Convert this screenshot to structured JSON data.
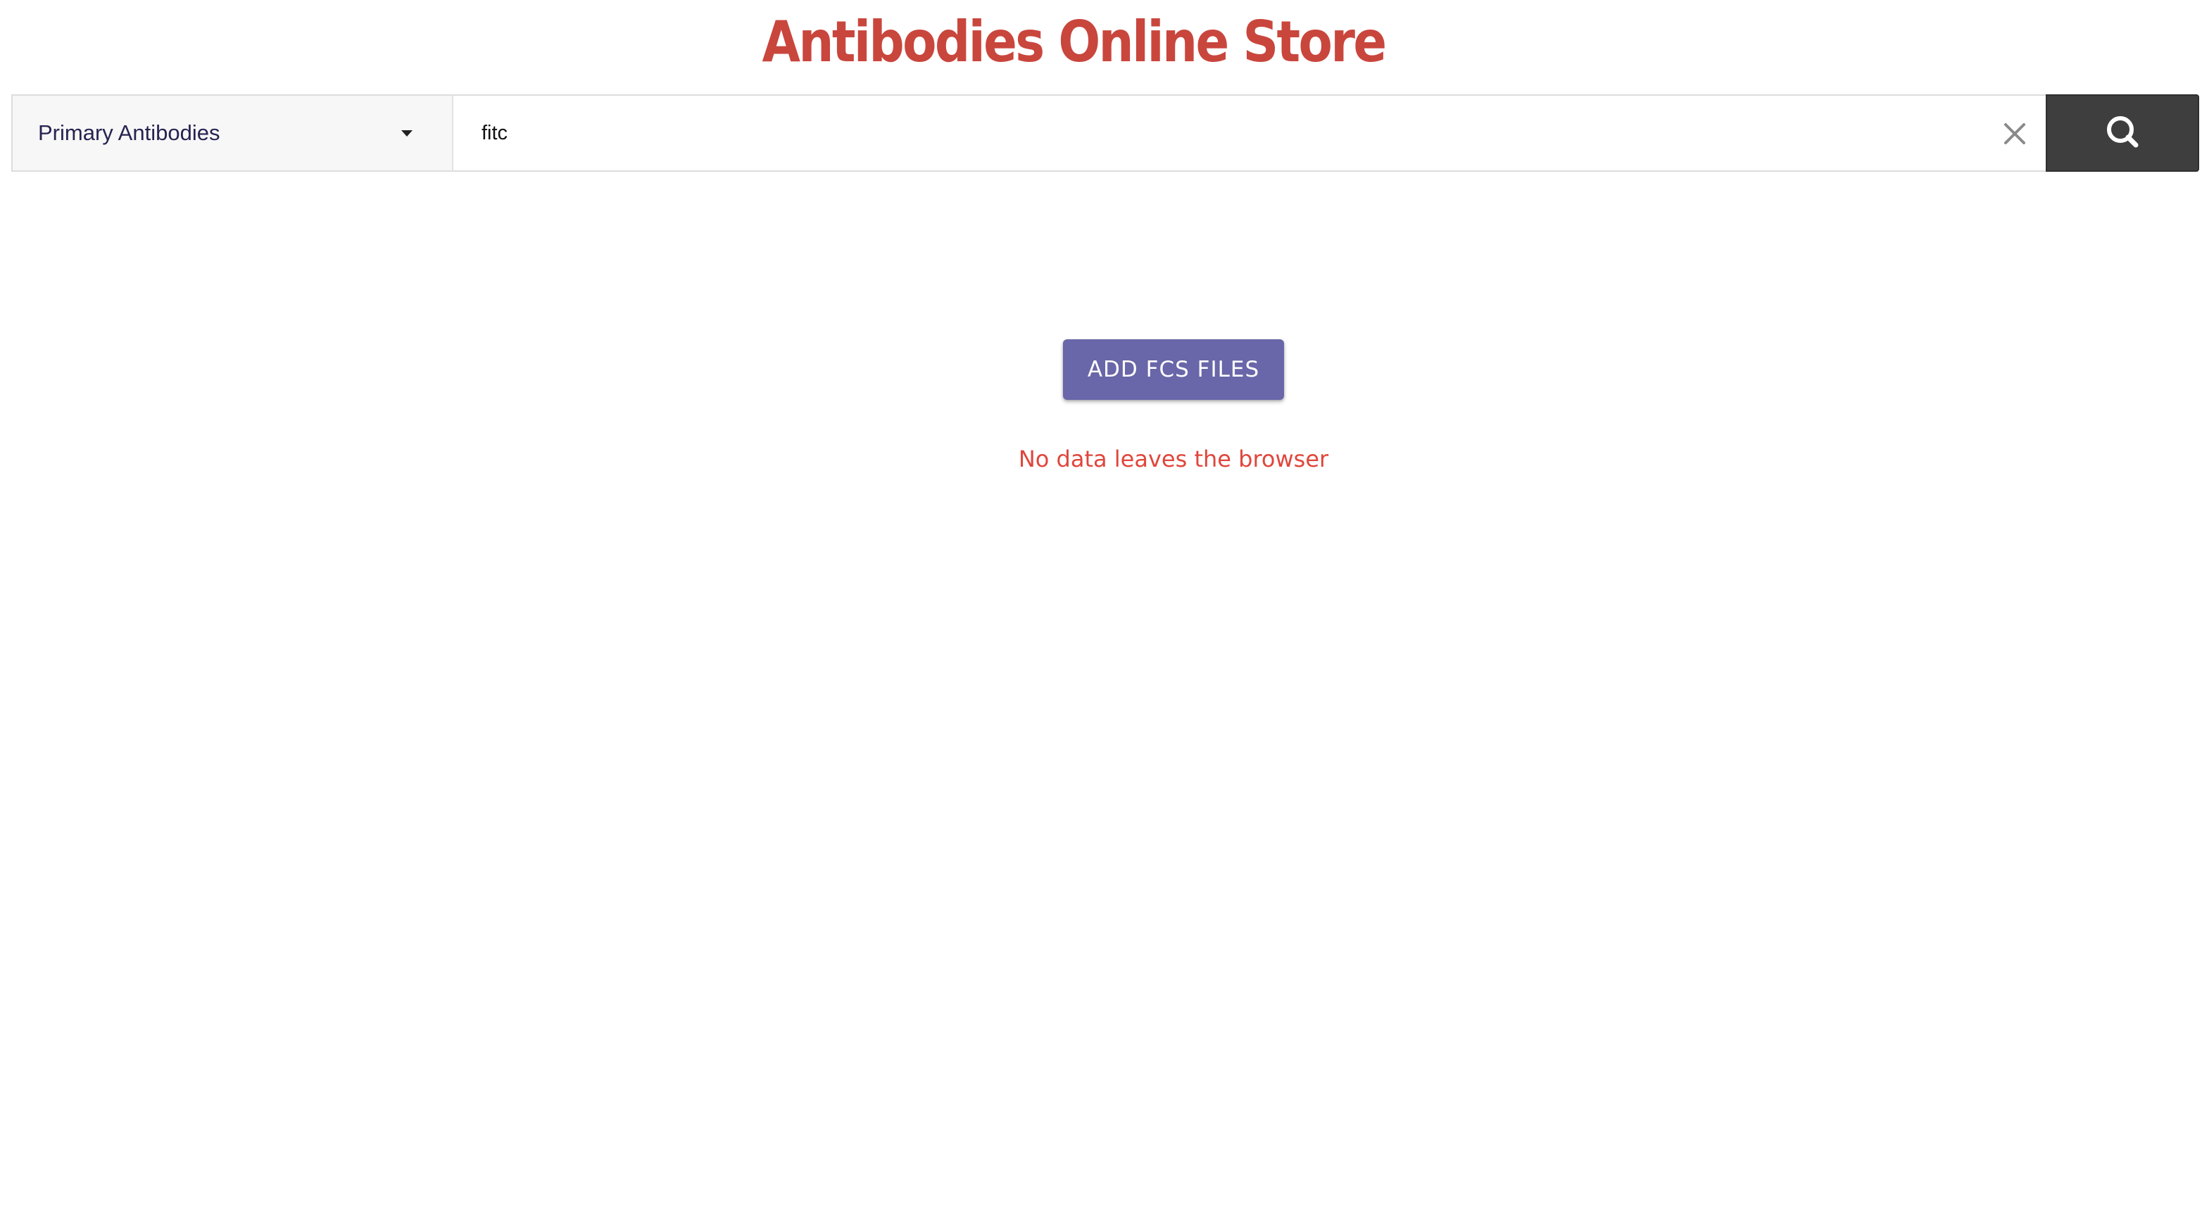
{
  "header": {
    "title": "Antibodies Online Store"
  },
  "search": {
    "category": "Primary Antibodies",
    "query": "fitc"
  },
  "main": {
    "add_button_label": "ADD FCS FILES",
    "privacy_note": "No data leaves the browser"
  },
  "icons": {
    "category_dropdown": "caret-down-icon",
    "clear": "close-icon",
    "search": "search-icon"
  },
  "colors": {
    "title": "#c9463d",
    "button": "#6966a9",
    "note": "#e0463c",
    "search_button": "#3e3e3e"
  }
}
